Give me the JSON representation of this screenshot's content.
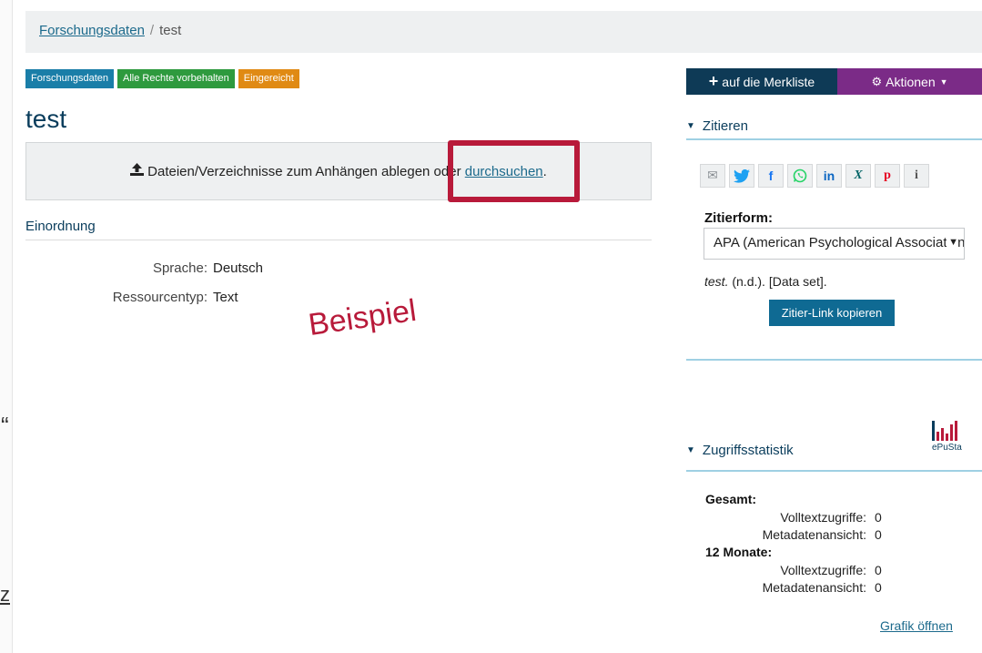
{
  "breadcrumb": {
    "parent": "Forschungsdaten",
    "separator": "/",
    "current": "test"
  },
  "badges": [
    {
      "label": "Forschungsdaten",
      "color": "#1a7ea8"
    },
    {
      "label": "Alle Rechte vorbehalten",
      "color": "#2e9a3e"
    },
    {
      "label": "Eingereicht",
      "color": "#e08a14"
    }
  ],
  "title": "test",
  "dropzone": {
    "text": "Dateien/Verzeichnisse zum Anhängen ablegen oder",
    "link": "durchsuchen",
    "suffix": "."
  },
  "section": {
    "heading": "Einordnung"
  },
  "metadata": [
    {
      "label": "Sprache:",
      "value": "Deutsch"
    },
    {
      "label": "Ressourcentyp:",
      "value": "Text"
    }
  ],
  "annotation": "Beispiel",
  "sidebar": {
    "merkliste_label": "auf die Merkliste",
    "aktionen_label": "Aktionen",
    "zitieren_heading": "Zitieren",
    "zitierform_label": "Zitierform:",
    "zitierform_value": "APA (American Psychological Association)",
    "citation_title": "test.",
    "citation_rest": " (n.d.). [Data set].",
    "copy_button": "Zitier-Link kopieren",
    "stats_heading": "Zugriffsstatistik",
    "epusta_label": "ePuSta"
  },
  "share_icons": [
    "mail-icon",
    "twitter-icon",
    "facebook-icon",
    "whatsapp-icon",
    "linkedin-icon",
    "xing-icon",
    "pinterest-icon",
    "info-icon"
  ],
  "stats": {
    "gesamt_label": "Gesamt:",
    "gesamt": [
      {
        "label": "Volltextzugriffe:",
        "value": "0"
      },
      {
        "label": "Metadatenansicht:",
        "value": "0"
      }
    ],
    "monate_label": "12 Monate:",
    "monate": [
      {
        "label": "Volltextzugriffe:",
        "value": "0"
      },
      {
        "label": "Metadatenansicht:",
        "value": "0"
      }
    ],
    "grafik_link": "Grafik öffnen"
  },
  "edge_fragments": {
    "quote": "“",
    "z": "z"
  },
  "colors": {
    "accent": "#0e3a56",
    "actions": "#7b2b87",
    "link": "#1c6a8c",
    "highlight": "#b81a3a"
  }
}
